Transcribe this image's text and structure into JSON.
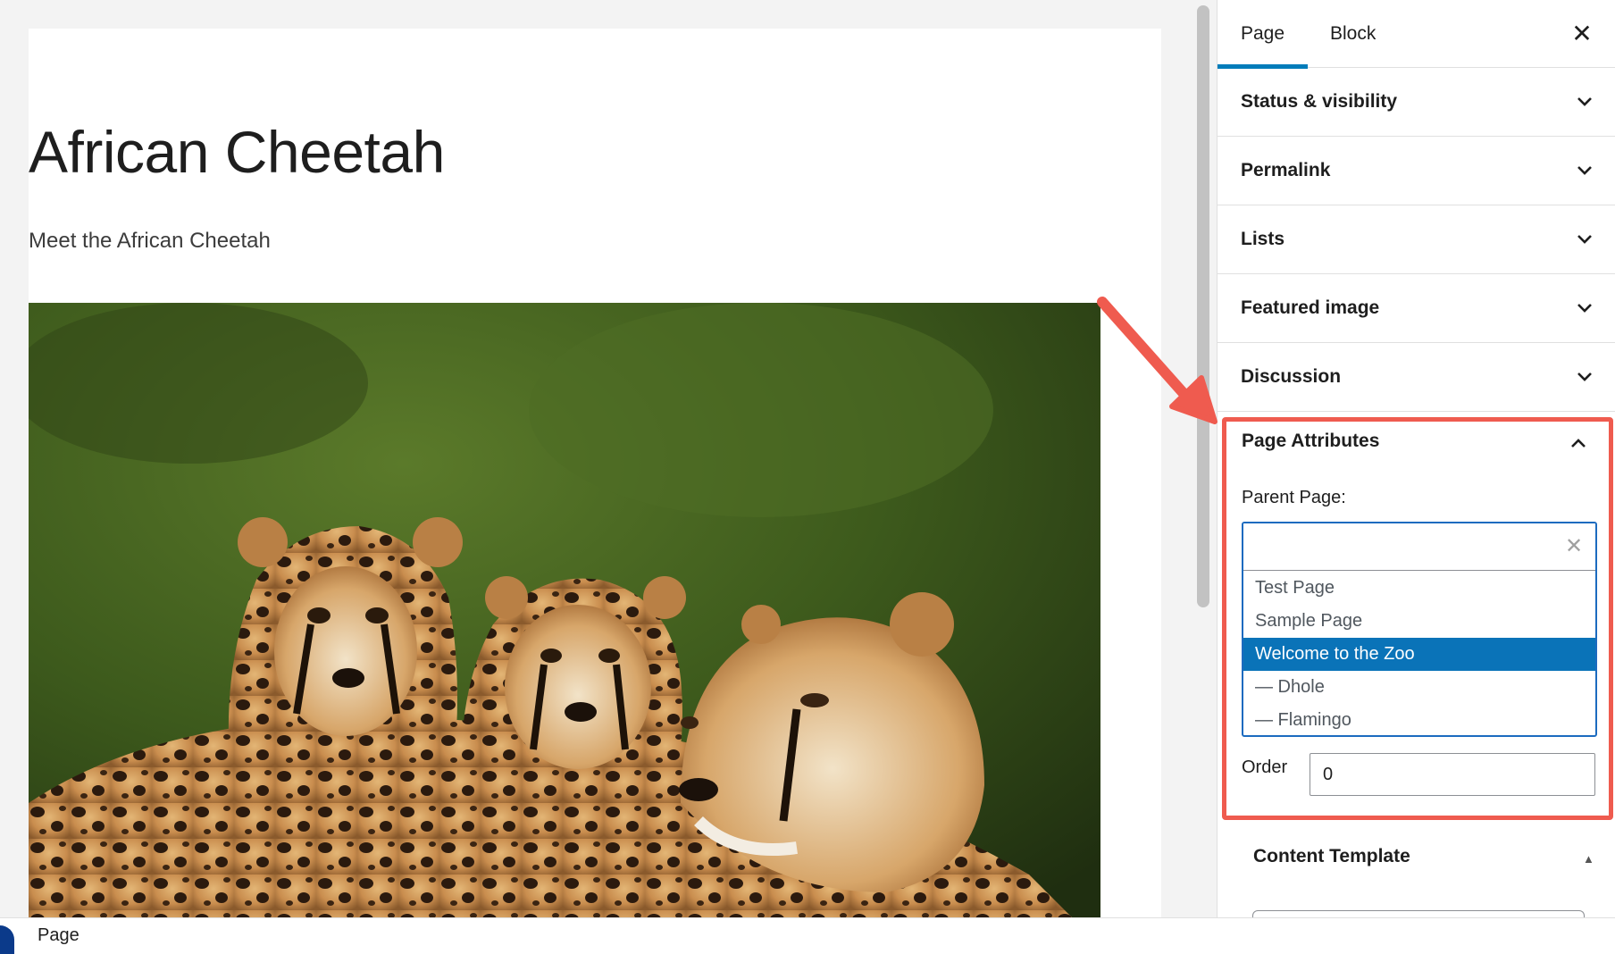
{
  "editor": {
    "title": "African Cheetah",
    "intro": "Meet the African Cheetah",
    "image": {
      "subject": "cheetah mother with two cubs"
    }
  },
  "sidebar": {
    "tabs": [
      {
        "label": "Page",
        "active": true
      },
      {
        "label": "Block",
        "active": false
      }
    ],
    "close_icon": "close-icon",
    "panels": [
      {
        "label": "Status & visibility",
        "expanded": false
      },
      {
        "label": "Permalink",
        "expanded": false
      },
      {
        "label": "Lists",
        "expanded": false
      },
      {
        "label": "Featured image",
        "expanded": false
      },
      {
        "label": "Discussion",
        "expanded": false
      }
    ],
    "page_attributes": {
      "title": "Page Attributes",
      "expanded": true,
      "parent_label": "Parent Page:",
      "parent_input_value": "",
      "options": [
        {
          "label": "Test Page",
          "selected": false
        },
        {
          "label": "Sample Page",
          "selected": false
        },
        {
          "label": "Welcome to the Zoo",
          "selected": true
        },
        {
          "label": "— Dhole",
          "selected": false
        },
        {
          "label": "— Flamingo",
          "selected": false
        }
      ],
      "order_label": "Order",
      "order_value": "0"
    },
    "content_template": {
      "title": "Content Template",
      "expanded": true
    }
  },
  "footer": {
    "breadcrumb": "Page"
  },
  "colors": {
    "accent": "#007cba",
    "selection": "#0a73b8",
    "highlight": "#ef5b4f"
  }
}
